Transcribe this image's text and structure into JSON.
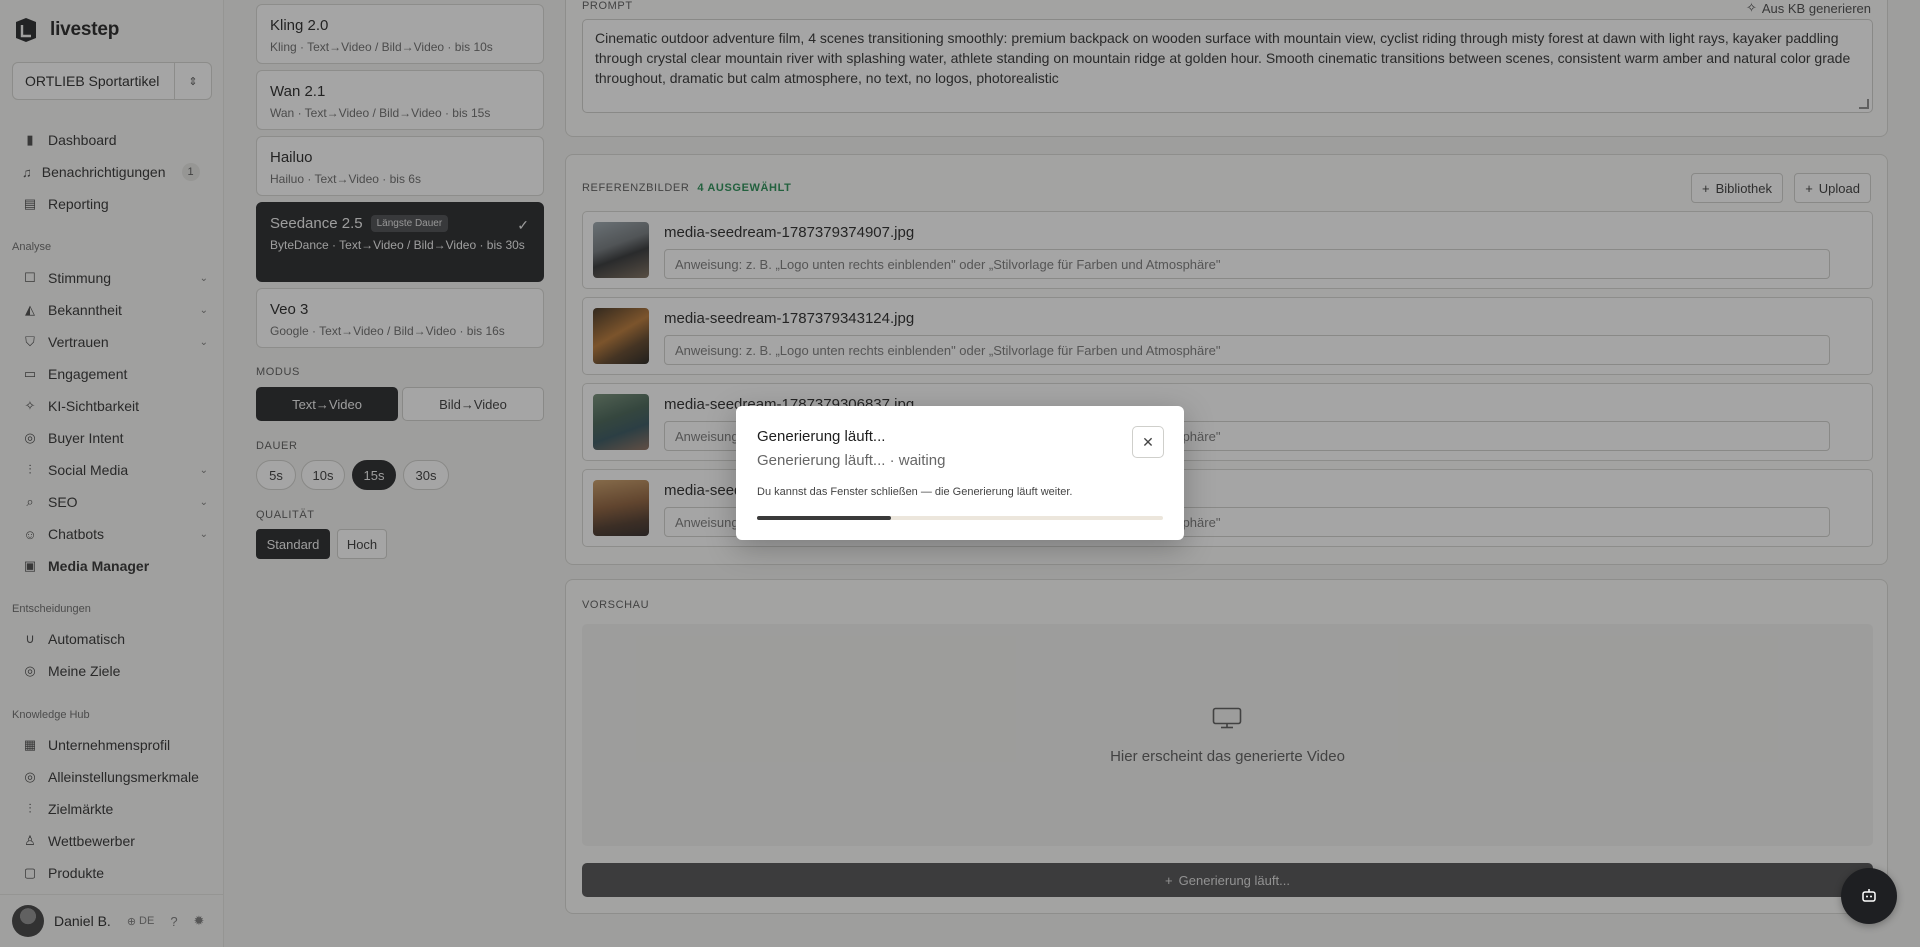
{
  "brand": {
    "name": "livestep"
  },
  "org": {
    "name": "ORTLIEB Sportartikel"
  },
  "nav": {
    "top": [
      {
        "label": "Dashboard",
        "icon": "bar-chart-icon"
      },
      {
        "label": "Benachrichtigungen",
        "icon": "bell-icon",
        "badge": "1"
      },
      {
        "label": "Reporting",
        "icon": "clipboard-icon"
      }
    ],
    "analyse_label": "Analyse",
    "analyse": [
      {
        "label": "Stimmung",
        "icon": "chat-icon",
        "chevron": true
      },
      {
        "label": "Bekanntheit",
        "icon": "megaphone-icon",
        "chevron": true
      },
      {
        "label": "Vertrauen",
        "icon": "shield-icon",
        "chevron": true
      },
      {
        "label": "Engagement",
        "icon": "message-square-icon"
      },
      {
        "label": "KI-Sichtbarkeit",
        "icon": "sparkle-icon"
      },
      {
        "label": "Buyer Intent",
        "icon": "target-icon"
      },
      {
        "label": "Social Media",
        "icon": "signal-icon",
        "chevron": true
      },
      {
        "label": "SEO",
        "icon": "search-icon",
        "chevron": true
      },
      {
        "label": "Chatbots",
        "icon": "bot-icon",
        "chevron": true
      },
      {
        "label": "Media Manager",
        "icon": "image-icon",
        "active": true
      }
    ],
    "decisions_label": "Entscheidungen",
    "decisions": [
      {
        "label": "Automatisch",
        "icon": "magnet-icon"
      },
      {
        "label": "Meine Ziele",
        "icon": "target-icon"
      }
    ],
    "knowledge_label": "Knowledge Hub",
    "knowledge": [
      {
        "label": "Unternehmensprofil",
        "icon": "building-icon"
      },
      {
        "label": "Alleinstellungsmerkmale",
        "icon": "target-icon"
      },
      {
        "label": "Zielmärkte",
        "icon": "signal-icon"
      },
      {
        "label": "Wettbewerber",
        "icon": "user-icon"
      },
      {
        "label": "Produkte",
        "icon": "box-icon"
      }
    ]
  },
  "user": {
    "name": "Daniel B.",
    "lang": "DE"
  },
  "models": [
    {
      "name": "Kling 2.0",
      "desc": "Kling · Text→Video / Bild→Video · bis 10s"
    },
    {
      "name": "Wan 2.1",
      "desc": "Wan · Text→Video / Bild→Video · bis 15s"
    },
    {
      "name": "Hailuo",
      "desc": "Hailuo · Text→Video · bis 6s"
    },
    {
      "name": "Seedance 2.5",
      "tag": "Längste Dauer",
      "desc": "ByteDance · Text→Video / Bild→Video · bis 30s",
      "selected": true
    },
    {
      "name": "Veo 3",
      "desc": "Google · Text→Video / Bild→Video · bis 16s"
    }
  ],
  "mode": {
    "label": "MODUS",
    "options": [
      "Text→Video",
      "Bild→Video"
    ],
    "selected": "Text→Video"
  },
  "duration": {
    "label": "DAUER",
    "options": [
      "5s",
      "10s",
      "15s",
      "30s"
    ],
    "selected": "15s"
  },
  "quality": {
    "label": "QUALITÄT",
    "options": [
      "Standard",
      "Hoch"
    ],
    "selected": "Standard"
  },
  "prompt": {
    "label": "PROMPT",
    "kb_link": "Aus KB generieren",
    "text": "Cinematic outdoor adventure film, 4 scenes transitioning smoothly: premium backpack on wooden surface with mountain view, cyclist riding through misty forest at dawn with light rays, kayaker paddling through crystal clear mountain river with splashing water, athlete standing on mountain ridge at golden hour. Smooth cinematic transitions between scenes, consistent warm amber and natural color grade throughout, dramatic but calm atmosphere, no text, no logos, photorealistic"
  },
  "references": {
    "label": "REFERENZBILDER",
    "count_label": "4 AUSGEWÄHLT",
    "library_button": "Bibliothek",
    "upload_button": "Upload",
    "placeholder": "Anweisung: z. B. „Logo unten rechts einblenden\" oder „Stilvorlage für Farben und Atmosphäre\"",
    "items": [
      {
        "filename": "media-seedream-1787379374907.jpg"
      },
      {
        "filename": "media-seedream-1787379343124.jpg"
      },
      {
        "filename": "media-seedream-1787379306837.jpg"
      },
      {
        "filename": "media-seed"
      }
    ]
  },
  "preview": {
    "label": "VORSCHAU",
    "empty_text": "Hier erscheint das generierte Video",
    "generate_button": "Generierung läuft..."
  },
  "modal": {
    "title": "Generierung läuft...",
    "status": "Generierung läuft... · waiting",
    "note": "Du kannst das Fenster schließen — die Generierung läuft weiter.",
    "progress": 0.33
  }
}
